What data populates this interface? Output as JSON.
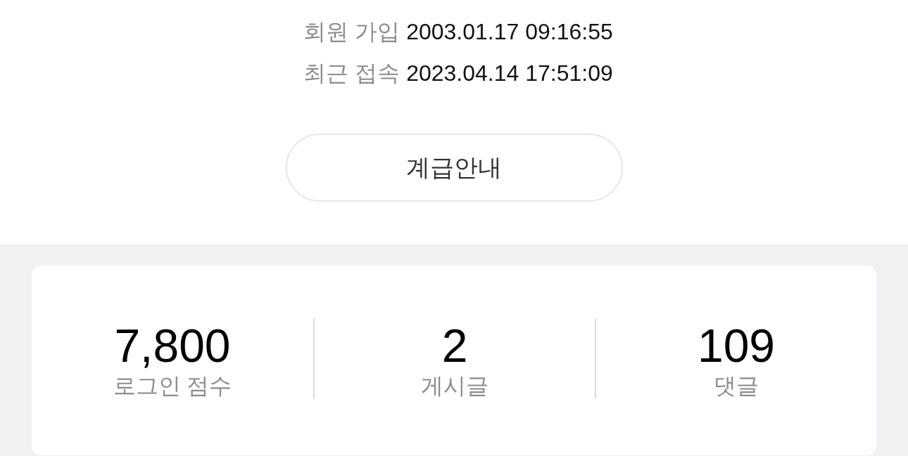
{
  "member_info": [
    {
      "label": "회원 가입",
      "value": "2003.01.17 09:16:55"
    },
    {
      "label": "최근 접속",
      "value": "2023.04.14 17:51:09"
    }
  ],
  "grade_button": {
    "label": "계급안내"
  },
  "stats": [
    {
      "value": "7,800",
      "label": "로그인 점수"
    },
    {
      "value": "2",
      "label": "게시글"
    },
    {
      "value": "109",
      "label": "댓글"
    }
  ]
}
